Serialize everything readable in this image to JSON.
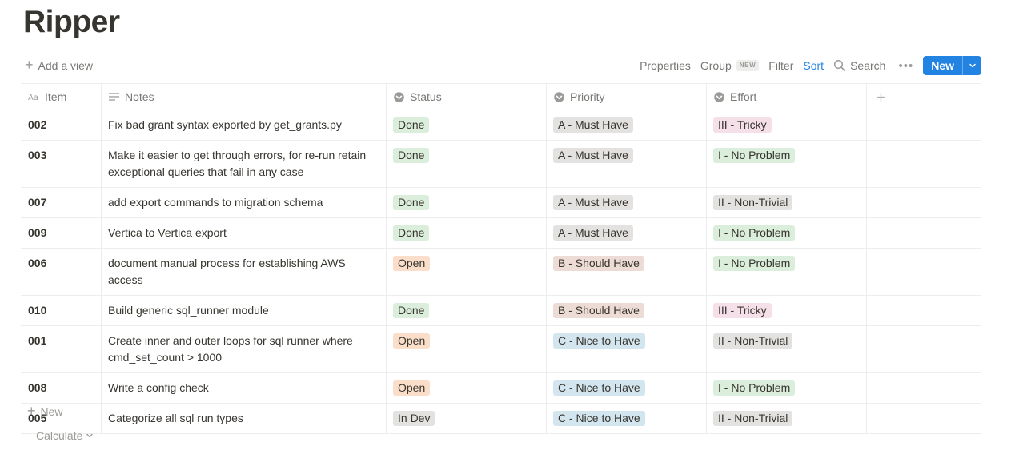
{
  "page": {
    "title": "Ripper"
  },
  "toolbar": {
    "add_view": "Add a view",
    "properties": "Properties",
    "group": "Group",
    "group_badge": "NEW",
    "filter": "Filter",
    "sort": "Sort",
    "search": "Search",
    "new_button": "New"
  },
  "columns": {
    "item": "Item",
    "notes": "Notes",
    "status": "Status",
    "priority": "Priority",
    "effort": "Effort"
  },
  "rows": [
    {
      "item": "002",
      "notes": "Fix bad grant syntax exported by get_grants.py",
      "status": "Done",
      "priority": "A - Must Have",
      "effort": "III - Tricky"
    },
    {
      "item": "003",
      "notes": "Make it easier to get through errors, for re-run retain exceptional queries that fail in any case",
      "status": "Done",
      "priority": "A - Must Have",
      "effort": "I - No Problem"
    },
    {
      "item": "007",
      "notes": "add export commands to migration schema",
      "status": "Done",
      "priority": "A - Must Have",
      "effort": "II - Non-Trivial"
    },
    {
      "item": "009",
      "notes": "Vertica to Vertica export",
      "status": "Done",
      "priority": "A - Must Have",
      "effort": "I - No Problem"
    },
    {
      "item": "006",
      "notes": "document manual process for establishing AWS access",
      "status": "Open",
      "priority": "B - Should Have",
      "effort": "I - No Problem"
    },
    {
      "item": "010",
      "notes": "Build generic sql_runner module",
      "status": "Done",
      "priority": "B - Should Have",
      "effort": "III - Tricky"
    },
    {
      "item": "001",
      "notes": "Create inner and outer loops for sql runner where cmd_set_count > 1000",
      "status": "Open",
      "priority": "C - Nice to Have",
      "effort": "II - Non-Trivial"
    },
    {
      "item": "008",
      "notes": "Write a config check",
      "status": "Open",
      "priority": "C - Nice to Have",
      "effort": "I - No Problem"
    },
    {
      "item": "005",
      "notes": "Categorize all sql run types",
      "status": "In Dev",
      "priority": "C - Nice to Have",
      "effort": "II - Non-Trivial"
    }
  ],
  "tag_colors": {
    "Done": "#dbeddb",
    "Open": "#fadec9",
    "In Dev": "#e3e2e0",
    "A - Must Have": "#e3e2e0",
    "B - Should Have": "#eddcd5",
    "C - Nice to Have": "#d3e5ef",
    "III - Tricky": "#f5e0e9",
    "I - No Problem": "#dbeddb",
    "II - Non-Trivial": "#e3e2e0"
  },
  "footer": {
    "new_row": "New",
    "calculate": "Calculate"
  },
  "icons": {
    "title_prop": "aa-title-icon",
    "notes_prop": "text-lines-icon",
    "select_prop": "select-chevron-icon",
    "add_column": "plus-icon",
    "search": "search-icon",
    "more": "more-dots-icon",
    "caret": "chevron-down-icon"
  }
}
